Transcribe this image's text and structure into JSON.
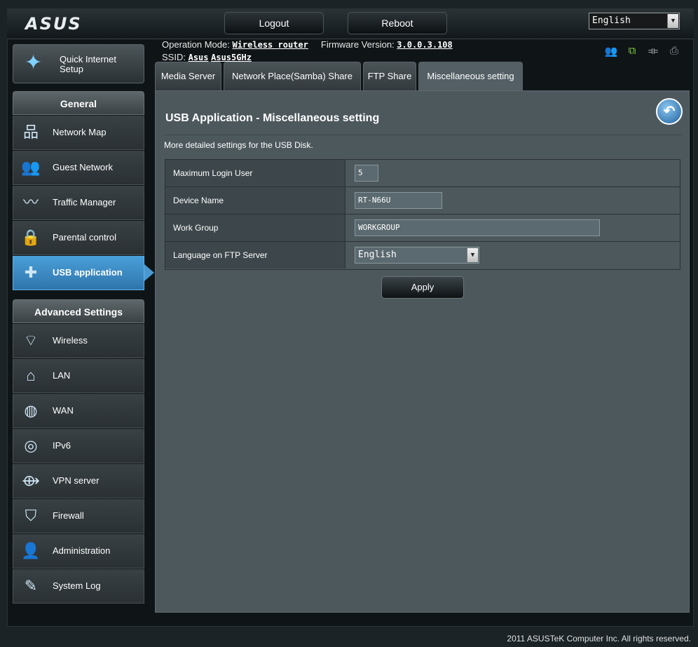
{
  "brand": {
    "logo": "ASUS"
  },
  "topbar": {
    "logout": "Logout",
    "reboot": "Reboot",
    "language": "English"
  },
  "info": {
    "op_mode_label": "Operation Mode:",
    "op_mode_value": "Wireless router",
    "firmware_label": "Firmware Version:",
    "firmware_value": "3.0.0.3.108",
    "ssid_label": "SSID:",
    "ssid_1": "Asus",
    "ssid_2": "Asus5GHz"
  },
  "status_icons": [
    "users-icon",
    "network-active-icon",
    "usb-icon",
    "printer-icon"
  ],
  "sidebar": {
    "quick_setup": "Quick Internet Setup",
    "general_heading": "General",
    "general_items": [
      {
        "label": "Network Map",
        "icon": "network-map-icon"
      },
      {
        "label": "Guest Network",
        "icon": "guest-network-icon"
      },
      {
        "label": "Traffic Manager",
        "icon": "traffic-manager-icon"
      },
      {
        "label": "Parental control",
        "icon": "lock-icon"
      },
      {
        "label": "USB application",
        "icon": "puzzle-icon",
        "active": true
      }
    ],
    "advanced_heading": "Advanced Settings",
    "advanced_items": [
      {
        "label": "Wireless",
        "icon": "wifi-icon"
      },
      {
        "label": "LAN",
        "icon": "home-icon"
      },
      {
        "label": "WAN",
        "icon": "globe-icon"
      },
      {
        "label": "IPv6",
        "icon": "ipv6-icon"
      },
      {
        "label": "VPN server",
        "icon": "vpn-icon"
      },
      {
        "label": "Firewall",
        "icon": "shield-icon"
      },
      {
        "label": "Administration",
        "icon": "admin-icon"
      },
      {
        "label": "System Log",
        "icon": "log-icon"
      }
    ]
  },
  "tabs": [
    {
      "label": "Media Server"
    },
    {
      "label": "Network Place(Samba) Share"
    },
    {
      "label": "FTP Share"
    },
    {
      "label": "Miscellaneous setting",
      "active": true
    }
  ],
  "main": {
    "title": "USB Application - Miscellaneous setting",
    "description": "More detailed settings for the USB Disk.",
    "fields": [
      {
        "label": "Maximum Login User",
        "value": "5"
      },
      {
        "label": "Device Name",
        "value": "RT-N66U"
      },
      {
        "label": "Work Group",
        "value": "WORKGROUP"
      },
      {
        "label": "Language on FTP Server",
        "value": "English"
      }
    ],
    "apply": "Apply"
  },
  "footer": "2011 ASUSTeK Computer Inc. All rights reserved.",
  "colors": {
    "accent": "#3f8cc8",
    "panel": "#4d585d",
    "background": "#1b2326"
  }
}
